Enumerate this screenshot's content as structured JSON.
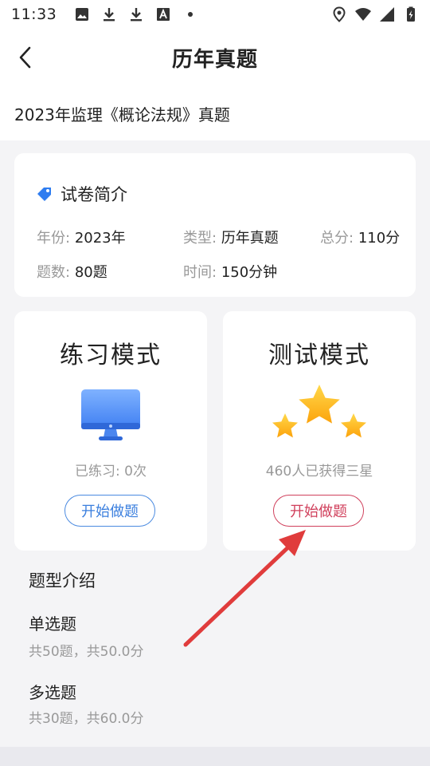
{
  "status_bar": {
    "time": "11:33",
    "left_icons": [
      "image-icon",
      "download-icon",
      "download-icon",
      "font-a-icon",
      "dot-icon"
    ],
    "right_icons": [
      "location-icon",
      "wifi-icon",
      "signal-icon",
      "battery-charging-icon"
    ]
  },
  "nav": {
    "back_icon": "chevron-left-icon",
    "title": "历年真题"
  },
  "exam": {
    "title": "2023年监理《概论法规》真题"
  },
  "intro": {
    "tag_icon": "tag-icon",
    "heading": "试卷简介",
    "items": [
      {
        "label": "年份:",
        "value": "2023年"
      },
      {
        "label": "类型:",
        "value": "历年真题"
      },
      {
        "label": "总分:",
        "value": "110分"
      },
      {
        "label": "题数:",
        "value": "80题"
      },
      {
        "label": "时间:",
        "value": "150分钟"
      }
    ]
  },
  "modes": {
    "practice": {
      "title": "练习模式",
      "icon": "monitor-icon",
      "subtitle": "已练习: 0次",
      "button": "开始做题"
    },
    "test": {
      "title": "测试模式",
      "icon": "three-stars-icon",
      "subtitle": "460人已获得三星",
      "button": "开始做题"
    }
  },
  "question_types": {
    "title": "题型介绍",
    "items": [
      {
        "name": "单选题",
        "desc": "共50题，共50.0分"
      },
      {
        "name": "多选题",
        "desc": "共30题，共60.0分"
      }
    ]
  },
  "colors": {
    "accent_blue": "#3b7fde",
    "accent_red": "#d0405c",
    "annotation_arrow": "#e03c3c",
    "star_yellow": "#fdbf1a"
  }
}
